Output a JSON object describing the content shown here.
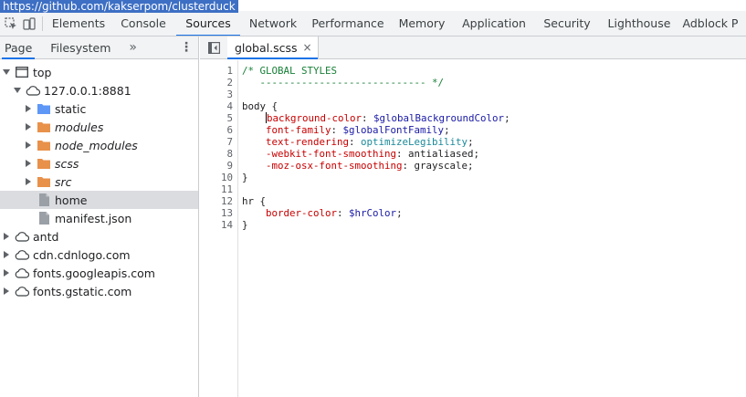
{
  "url_tooltip": "https://github.com/kakserpom/clusterduck",
  "main_tabs": [
    {
      "label": "Elements",
      "w": 70
    },
    {
      "label": "Console",
      "w": 72
    },
    {
      "label": "Sources",
      "w": 70
    },
    {
      "label": "Network",
      "w": 72
    },
    {
      "label": "Performance",
      "w": 92
    },
    {
      "label": "Memory",
      "w": 70
    },
    {
      "label": "Application",
      "w": 88
    },
    {
      "label": "Security",
      "w": 72
    },
    {
      "label": "Lighthouse",
      "w": 86
    },
    {
      "label": "Adblock P",
      "w": 70
    }
  ],
  "active_main_tab": "Sources",
  "left_tabs": {
    "page": "Page",
    "filesystem": "Filesystem",
    "more": "»",
    "menu": "⋮"
  },
  "tree": [
    {
      "label": "top",
      "icon": "frame",
      "expanded": true,
      "level": 0,
      "selected": false,
      "italic": false
    },
    {
      "label": "127.0.0.1:8881",
      "icon": "cloud",
      "expanded": true,
      "level": 1,
      "selected": false,
      "italic": false
    },
    {
      "label": "static",
      "icon": "folder-blue",
      "expanded": false,
      "level": 2,
      "selected": false,
      "italic": false
    },
    {
      "label": "modules",
      "icon": "folder-orange",
      "expanded": false,
      "level": 2,
      "selected": false,
      "italic": true
    },
    {
      "label": "node_modules",
      "icon": "folder-orange",
      "expanded": false,
      "level": 2,
      "selected": false,
      "italic": true
    },
    {
      "label": "scss",
      "icon": "folder-orange",
      "expanded": false,
      "level": 2,
      "selected": false,
      "italic": true
    },
    {
      "label": "src",
      "icon": "folder-orange",
      "expanded": false,
      "level": 2,
      "selected": false,
      "italic": true
    },
    {
      "label": "home",
      "icon": "file",
      "expanded": null,
      "level": 2,
      "selected": true,
      "italic": false
    },
    {
      "label": "manifest.json",
      "icon": "file",
      "expanded": null,
      "level": 2,
      "selected": false,
      "italic": false
    },
    {
      "label": "antd",
      "icon": "cloud",
      "expanded": false,
      "level": 0,
      "selected": false,
      "italic": false
    },
    {
      "label": "cdn.cdnlogo.com",
      "icon": "cloud",
      "expanded": false,
      "level": 0,
      "selected": false,
      "italic": false
    },
    {
      "label": "fonts.googleapis.com",
      "icon": "cloud",
      "expanded": false,
      "level": 0,
      "selected": false,
      "italic": false
    },
    {
      "label": "fonts.gstatic.com",
      "icon": "cloud",
      "expanded": false,
      "level": 0,
      "selected": false,
      "italic": false
    }
  ],
  "file_tab": {
    "name": "global.scss",
    "close": "×"
  },
  "code_lines": [
    [
      {
        "t": "/* GLOBAL STYLES",
        "c": "comment"
      }
    ],
    [
      {
        "t": "   ---------------------------- */",
        "c": "comment"
      }
    ],
    [],
    [
      {
        "t": "body {",
        "c": ""
      }
    ],
    [
      {
        "t": "    ",
        "c": ""
      },
      {
        "t": "|",
        "c": "cursor"
      },
      {
        "t": "background-color",
        "c": "prop"
      },
      {
        "t": ": ",
        "c": ""
      },
      {
        "t": "$globalBackgroundColor",
        "c": "var"
      },
      {
        "t": ";",
        "c": ""
      }
    ],
    [
      {
        "t": "    ",
        "c": ""
      },
      {
        "t": "font-family",
        "c": "prop"
      },
      {
        "t": ": ",
        "c": ""
      },
      {
        "t": "$globalFontFamily",
        "c": "var"
      },
      {
        "t": ";",
        "c": ""
      }
    ],
    [
      {
        "t": "    ",
        "c": ""
      },
      {
        "t": "text-rendering",
        "c": "prop"
      },
      {
        "t": ": ",
        "c": ""
      },
      {
        "t": "optimizeLegibility",
        "c": "kw"
      },
      {
        "t": ";",
        "c": ""
      }
    ],
    [
      {
        "t": "    ",
        "c": ""
      },
      {
        "t": "-webkit-font-smoothing",
        "c": "prop"
      },
      {
        "t": ": antialiased;",
        "c": ""
      }
    ],
    [
      {
        "t": "    ",
        "c": ""
      },
      {
        "t": "-moz-osx-font-smoothing",
        "c": "prop"
      },
      {
        "t": ": grayscale;",
        "c": ""
      }
    ],
    [
      {
        "t": "}",
        "c": ""
      }
    ],
    [],
    [
      {
        "t": "hr {",
        "c": ""
      }
    ],
    [
      {
        "t": "    ",
        "c": ""
      },
      {
        "t": "border-color",
        "c": "prop"
      },
      {
        "t": ": ",
        "c": ""
      },
      {
        "t": "$hrColor",
        "c": "var"
      },
      {
        "t": ";",
        "c": ""
      }
    ],
    [
      {
        "t": "}",
        "c": ""
      }
    ]
  ],
  "colors": {
    "accent": "#1a73e8",
    "folder_blue": "#5e97f6",
    "folder_orange": "#e8914a",
    "file_gray": "#9aa0a6"
  }
}
